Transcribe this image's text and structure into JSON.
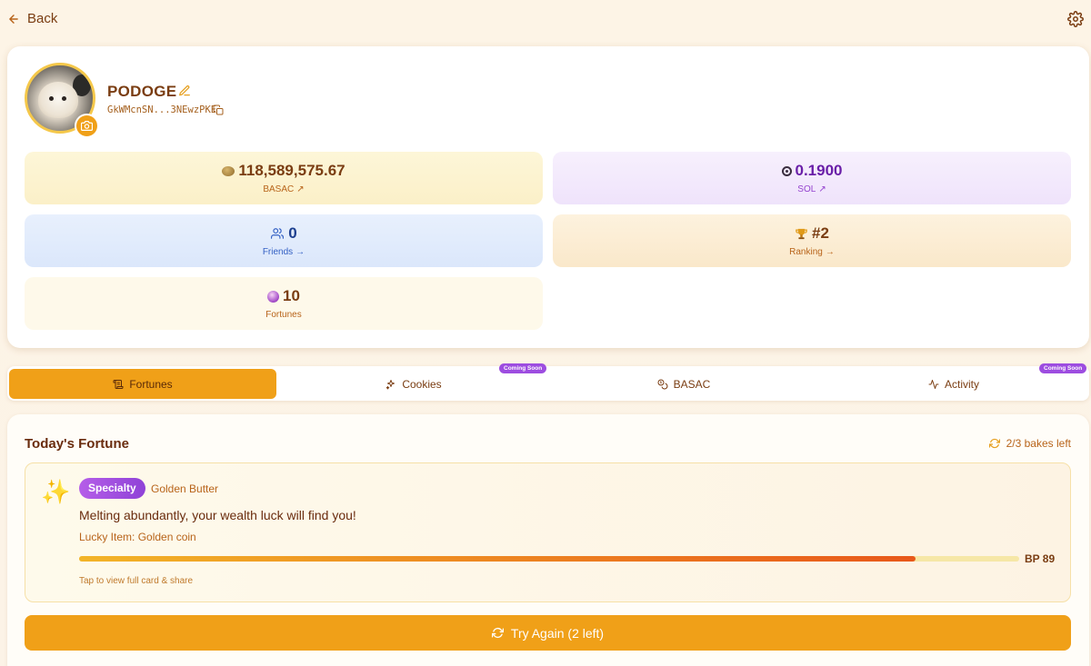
{
  "nav": {
    "back_label": "Back"
  },
  "profile": {
    "username": "PODOGE",
    "wallet": "GkWMcnSN...3NEwzPKE"
  },
  "stats": {
    "basac": {
      "value": "118,589,575.67",
      "label": "BASAC",
      "arrow": "↗"
    },
    "sol": {
      "value": "0.1900",
      "label": "SOL",
      "arrow": "↗"
    },
    "friends": {
      "value": "0",
      "label": "Friends",
      "arrow": "→"
    },
    "ranking": {
      "value": "#2",
      "label": "Ranking",
      "arrow": "→"
    },
    "fortunes": {
      "value": "10",
      "label": "Fortunes"
    }
  },
  "tabs": [
    {
      "label": "Fortunes",
      "active": true
    },
    {
      "label": "Cookies",
      "badge": "Coming Soon"
    },
    {
      "label": "BASAC"
    },
    {
      "label": "Activity",
      "badge": "Coming Soon"
    }
  ],
  "fortune": {
    "section_title": "Today's Fortune",
    "bakes_left": "2/3 bakes left",
    "badge": "Specialty",
    "flavor": "Golden Butter",
    "message": "Melting abundantly, your wealth luck will find you!",
    "lucky_item": "Lucky Item: Golden coin",
    "bp_label": "BP 89",
    "bp_fraction": 0.89,
    "tap_hint": "Tap to view full card & share",
    "try_again": "Try Again (2 left)"
  },
  "colors": {
    "accent": "#f0a018",
    "text": "#7a3d12",
    "purple": "#9d4de0"
  }
}
